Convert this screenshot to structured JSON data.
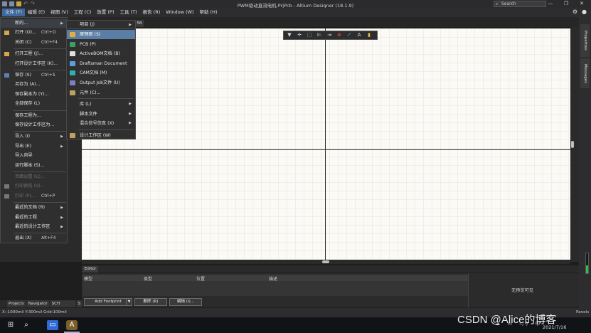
{
  "window": {
    "title": "PWM驱动直流电机.PrjPcb - Altium Designer (18.1.9)",
    "search_placeholder": "Search",
    "controls": [
      "—",
      "❐",
      "✕"
    ]
  },
  "menubar": {
    "items": [
      "文件 (F)",
      "编辑 (E)",
      "视图 (V)",
      "工程 (C)",
      "放置 (P)",
      "工具 (T)",
      "报告 (R)",
      "Window (W)",
      "帮助 (H)"
    ],
    "active_index": 0,
    "right_icons": [
      "gear-icon",
      "user-icon"
    ]
  },
  "document_tab": "5B",
  "file_menu": {
    "items": [
      {
        "label": "新的...",
        "shortcut": "",
        "arrow": true,
        "state": "highlight",
        "icon": ""
      },
      {
        "label": "打开 (O)...",
        "shortcut": "Ctrl+O",
        "arrow": false,
        "state": "",
        "icon": "folder"
      },
      {
        "label": "关闭 (C)",
        "shortcut": "Ctrl+F4",
        "arrow": false,
        "state": "",
        "icon": ""
      },
      {
        "sep": true
      },
      {
        "label": "打开工程 (J)...",
        "shortcut": "",
        "arrow": false,
        "state": "",
        "icon": "project"
      },
      {
        "label": "打开设计工作区 (K)...",
        "shortcut": "",
        "arrow": false,
        "state": "",
        "icon": ""
      },
      {
        "sep": true
      },
      {
        "label": "保存 (S)",
        "shortcut": "Ctrl+S",
        "arrow": false,
        "state": "",
        "icon": "save"
      },
      {
        "label": "另存为 (A)...",
        "shortcut": "",
        "arrow": false,
        "state": "",
        "icon": ""
      },
      {
        "label": "保存副本为 (Y)...",
        "shortcut": "",
        "arrow": false,
        "state": "",
        "icon": ""
      },
      {
        "label": "全部保存 (L)",
        "shortcut": "",
        "arrow": false,
        "state": "",
        "icon": ""
      },
      {
        "sep": true
      },
      {
        "label": "保存工程为...",
        "shortcut": "",
        "arrow": false,
        "state": "",
        "icon": ""
      },
      {
        "label": "保存设计工作区为...",
        "shortcut": "",
        "arrow": false,
        "state": "",
        "icon": ""
      },
      {
        "sep": true
      },
      {
        "label": "导入 (I)",
        "shortcut": "",
        "arrow": true,
        "state": "",
        "icon": ""
      },
      {
        "label": "导出 (E)",
        "shortcut": "",
        "arrow": true,
        "state": "",
        "icon": ""
      },
      {
        "label": "导入向导",
        "shortcut": "",
        "arrow": false,
        "state": "",
        "icon": ""
      },
      {
        "label": "运行脚本 (S)...",
        "shortcut": "",
        "arrow": false,
        "state": "",
        "icon": ""
      },
      {
        "sep": true
      },
      {
        "label": "页面设置 (U)...",
        "shortcut": "",
        "arrow": false,
        "state": "disabled",
        "icon": ""
      },
      {
        "label": "打印预览 (V)...",
        "shortcut": "",
        "arrow": false,
        "state": "disabled",
        "icon": "preview"
      },
      {
        "label": "打印 (P)...",
        "shortcut": "Ctrl+P",
        "arrow": false,
        "state": "disabled",
        "icon": "printer"
      },
      {
        "sep": true
      },
      {
        "label": "最近的文档 (R)",
        "shortcut": "",
        "arrow": true,
        "state": "",
        "icon": ""
      },
      {
        "label": "最近的工程",
        "shortcut": "",
        "arrow": true,
        "state": "",
        "icon": ""
      },
      {
        "label": "最近的设计工作区",
        "shortcut": "",
        "arrow": true,
        "state": "",
        "icon": ""
      },
      {
        "sep": true
      },
      {
        "label": "退出 (X)",
        "shortcut": "Alt+F4",
        "arrow": false,
        "state": "",
        "icon": ""
      }
    ]
  },
  "new_submenu": {
    "header": "项目 (J)",
    "items": [
      {
        "label": "原理图 (S)",
        "icon": "schematic",
        "color": "#e0b040",
        "arrow": false,
        "selected": true
      },
      {
        "label": "PCB (P)",
        "icon": "pcb",
        "color": "#3aa060",
        "arrow": false,
        "selected": false
      },
      {
        "label": "ActiveBOM文档 (B)",
        "icon": "bom",
        "color": "#e0e0e0",
        "arrow": false,
        "selected": false
      },
      {
        "label": "Draftsman Document",
        "icon": "draftsman",
        "color": "#5aa0e0",
        "arrow": false,
        "selected": false
      },
      {
        "label": "CAM文档 (M)",
        "icon": "cam",
        "color": "#30b0b0",
        "arrow": false,
        "selected": false
      },
      {
        "label": "Output Job文件 (U)",
        "icon": "outjob",
        "color": "#8080c0",
        "arrow": false,
        "selected": false
      },
      {
        "label": "元件 (C)...",
        "icon": "component",
        "color": "#c0a060",
        "arrow": false,
        "selected": false
      },
      {
        "sep": true
      },
      {
        "label": "库 (L)",
        "icon": "",
        "color": "",
        "arrow": true,
        "selected": false
      },
      {
        "label": "脚本文件",
        "icon": "",
        "color": "",
        "arrow": true,
        "selected": false
      },
      {
        "label": "混合信号仿真 (X)",
        "icon": "",
        "color": "",
        "arrow": true,
        "selected": false
      },
      {
        "sep": true
      },
      {
        "label": "设计工作区 (W)",
        "icon": "workspace",
        "color": "#c0a060",
        "arrow": false,
        "selected": false
      }
    ]
  },
  "floating_toolbar": [
    "filter-icon",
    "move-icon",
    "select-rect-icon",
    "align-icon",
    "place-port-icon",
    "component-icon",
    "wire-icon",
    "text-icon",
    "note-icon"
  ],
  "right_panel_tabs": [
    "Properties",
    "Messages"
  ],
  "editor": {
    "tab": "Editor",
    "columns": [
      "模型",
      "类型",
      "位置",
      "描述"
    ],
    "preview_text": "无预览可见",
    "buttons": {
      "add_footprint": "Add Footprint",
      "delete": "删除 (R)",
      "edit": "编辑 (I)..."
    }
  },
  "panel_tabs": [
    "Projects",
    "Navigator",
    "SCH Library",
    "S"
  ],
  "statusbar": {
    "coords": "X:-1000mil Y:300mil   Grid:100mil",
    "panels": "Panels"
  },
  "taskbar": {
    "clock_date": "2021/7/16",
    "tray": "^ ☁ ▭ ◁) 中"
  },
  "watermark": "CSDN @Alice的博客"
}
